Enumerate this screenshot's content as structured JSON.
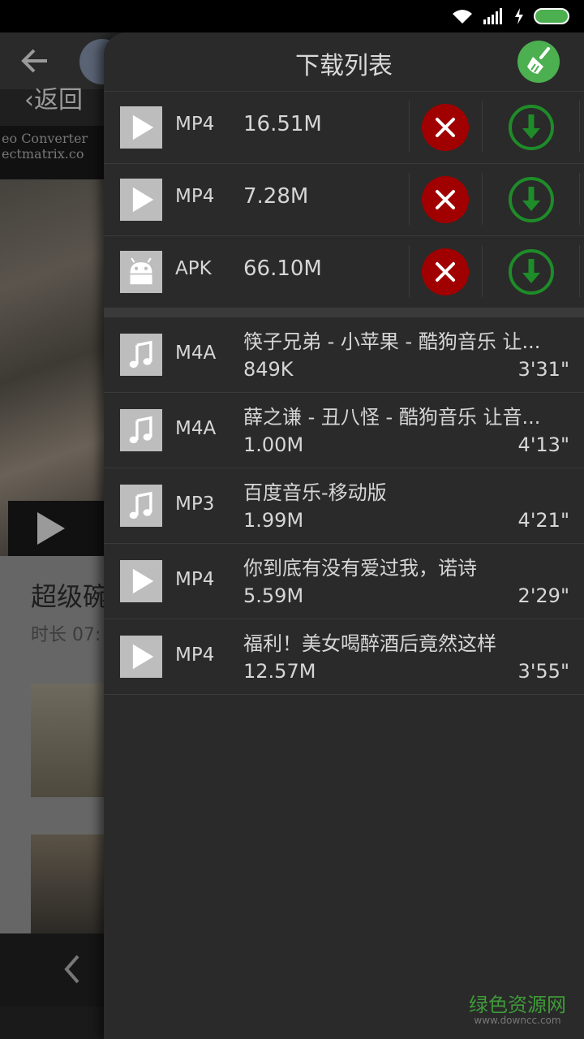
{
  "background": {
    "return_label": "返回",
    "video_overlay_text": "eo Converter\nectmatrix.co",
    "title": "超级碗",
    "duration": "时长 07:"
  },
  "panel": {
    "title": "下载列表",
    "downloading": [
      {
        "type": "MP4",
        "size": "16.51M",
        "icon": "video-icon"
      },
      {
        "type": "MP4",
        "size": "7.28M",
        "icon": "video-icon"
      },
      {
        "type": "APK",
        "size": "66.10M",
        "icon": "android-icon"
      }
    ],
    "downloaded": [
      {
        "type": "M4A",
        "name": "筷子兄弟 - 小苹果 - 酷狗音乐 让...",
        "size": "849K",
        "duration": "3'31\"",
        "icon": "music-icon"
      },
      {
        "type": "M4A",
        "name": "薛之谦 - 丑八怪 - 酷狗音乐 让音...",
        "size": "1.00M",
        "duration": "4'13\"",
        "icon": "music-icon"
      },
      {
        "type": "MP3",
        "name": "百度音乐-移动版",
        "size": "1.99M",
        "duration": "4'21\"",
        "icon": "music-icon"
      },
      {
        "type": "MP4",
        "name": "你到底有没有爱过我，诺诗",
        "size": "5.59M",
        "duration": "2'29\"",
        "icon": "video-icon"
      },
      {
        "type": "MP4",
        "name": "福利！美女喝醉酒后竟然这样",
        "size": "12.57M",
        "duration": "3'55\"",
        "icon": "video-icon"
      }
    ]
  },
  "watermark": {
    "main": "绿色资源网",
    "sub": "www.downcc.com"
  },
  "colors": {
    "cancel": "#a00000",
    "download": "#1e8c28",
    "clean": "#4caf50",
    "battery": "#4caf50"
  }
}
